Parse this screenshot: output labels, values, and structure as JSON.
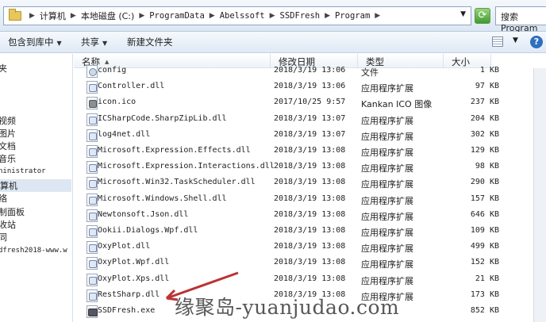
{
  "address": {
    "crumbs": [
      "计算机",
      "本地磁盘 (C:)",
      "ProgramData",
      "Abelssoft",
      "SSDFresh",
      "Program"
    ],
    "search_placeholder": "搜索 Program"
  },
  "toolbar": {
    "include_library": "包含到库中",
    "share": "共享",
    "new_folder": "新建文件夹"
  },
  "nav": {
    "items": [
      {
        "label": "夹"
      },
      {
        "label": "视频"
      },
      {
        "label": "图片"
      },
      {
        "label": "文档"
      },
      {
        "label": "音乐"
      },
      {
        "label": "ninistrator"
      },
      {
        "label": "算机"
      },
      {
        "label": "络"
      },
      {
        "label": "制面板"
      },
      {
        "label": "收站"
      },
      {
        "label": "同"
      },
      {
        "label": "dfresh2018-www.w"
      }
    ]
  },
  "columns": {
    "name": "名称",
    "date": "修改日期",
    "type": "类型",
    "size": "大小"
  },
  "files": [
    {
      "icon": "config-file-icon",
      "name": "config",
      "date": "2018/3/19 13:06",
      "type": "文件",
      "size": "1 KB"
    },
    {
      "icon": "dll-file-icon",
      "name": "Controller.dll",
      "date": "2018/3/19 13:06",
      "type": "应用程序扩展",
      "size": "97 KB"
    },
    {
      "icon": "image-file-icon",
      "name": "icon.ico",
      "date": "2017/10/25 9:57",
      "type": "Kankan ICO 图像",
      "size": "237 KB"
    },
    {
      "icon": "dll-file-icon",
      "name": "ICSharpCode.SharpZipLib.dll",
      "date": "2018/3/19 13:07",
      "type": "应用程序扩展",
      "size": "204 KB"
    },
    {
      "icon": "dll-file-icon",
      "name": "log4net.dll",
      "date": "2018/3/19 13:07",
      "type": "应用程序扩展",
      "size": "302 KB"
    },
    {
      "icon": "dll-file-icon",
      "name": "Microsoft.Expression.Effects.dll",
      "date": "2018/3/19 13:08",
      "type": "应用程序扩展",
      "size": "129 KB"
    },
    {
      "icon": "dll-file-icon",
      "name": "Microsoft.Expression.Interactions.dll",
      "date": "2018/3/19 13:08",
      "type": "应用程序扩展",
      "size": "98 KB"
    },
    {
      "icon": "dll-file-icon",
      "name": "Microsoft.Win32.TaskScheduler.dll",
      "date": "2018/3/19 13:08",
      "type": "应用程序扩展",
      "size": "290 KB"
    },
    {
      "icon": "dll-file-icon",
      "name": "Microsoft.Windows.Shell.dll",
      "date": "2018/3/19 13:08",
      "type": "应用程序扩展",
      "size": "157 KB"
    },
    {
      "icon": "dll-file-icon",
      "name": "Newtonsoft.Json.dll",
      "date": "2018/3/19 13:08",
      "type": "应用程序扩展",
      "size": "646 KB"
    },
    {
      "icon": "dll-file-icon",
      "name": "Ookii.Dialogs.Wpf.dll",
      "date": "2018/3/19 13:08",
      "type": "应用程序扩展",
      "size": "109 KB"
    },
    {
      "icon": "dll-file-icon",
      "name": "OxyPlot.dll",
      "date": "2018/3/19 13:08",
      "type": "应用程序扩展",
      "size": "499 KB"
    },
    {
      "icon": "dll-file-icon",
      "name": "OxyPlot.Wpf.dll",
      "date": "2018/3/19 13:08",
      "type": "应用程序扩展",
      "size": "152 KB"
    },
    {
      "icon": "dll-file-icon",
      "name": "OxyPlot.Xps.dll",
      "date": "2018/3/19 13:08",
      "type": "应用程序扩展",
      "size": "21 KB"
    },
    {
      "icon": "dll-file-icon",
      "name": "RestSharp.dll",
      "date": "2018/3/19 13:08",
      "type": "应用程序扩展",
      "size": "173 KB"
    },
    {
      "icon": "exe-file-icon",
      "name": "SSDFresh.exe",
      "date": "",
      "type": "",
      "size": "852 KB"
    }
  ],
  "watermark": "缘聚岛-yuanjudao.com"
}
